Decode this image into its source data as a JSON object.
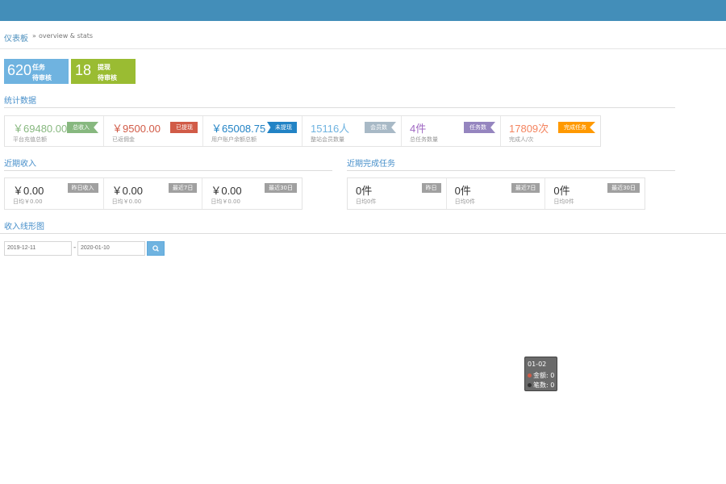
{
  "breadcrumb": {
    "home": "仪表板",
    "separator": "»",
    "sub": "overview & stats"
  },
  "infoboxes": [
    {
      "number": "620",
      "line1": "任务",
      "line2": "待审核"
    },
    {
      "number": "18",
      "line1": "提现",
      "line2": "待审核"
    }
  ],
  "stats": {
    "title": "统计数据",
    "cells": [
      {
        "value": "￥69480.00",
        "sub": "平台充值总额",
        "badge": "总收入",
        "color": "#87b87f",
        "badge_color": "#87b87f"
      },
      {
        "value": "￥9500.00",
        "sub": "已返佣金",
        "badge": "已提现",
        "color": "#d15b47",
        "badge_color": "#d15b47"
      },
      {
        "value": "￥65008.75",
        "sub": "用户账户余额总额",
        "badge": "未提现",
        "color": "#2283c5",
        "badge_color": "#2283c5"
      },
      {
        "value": "15116人",
        "sub": "整站会员数量",
        "badge": "会员数",
        "color": "#6fb3e0",
        "badge_color": "#a8b9c6"
      },
      {
        "value": "4件",
        "sub": "总任务数量",
        "badge": "任务数",
        "color": "#a069c3",
        "badge_color": "#9585bf"
      },
      {
        "value": "17809次",
        "sub": "完成人/次",
        "badge": "完成任务",
        "color": "#f4845f",
        "badge_color": "#ff9900"
      }
    ]
  },
  "income": {
    "title": "近期收入",
    "cells": [
      {
        "value": "￥0.00",
        "sub": "日均￥0.00",
        "badge": "昨日收入"
      },
      {
        "value": "￥0.00",
        "sub": "日均￥0.00",
        "badge": "最近7日"
      },
      {
        "value": "￥0.00",
        "sub": "日均￥0.00",
        "badge": "最近30日"
      }
    ]
  },
  "tasks": {
    "title": "近期完成任务",
    "cells": [
      {
        "value": "0件",
        "sub": "日均0件",
        "badge": "昨日"
      },
      {
        "value": "0件",
        "sub": "日均0件",
        "badge": "最近7日"
      },
      {
        "value": "0件",
        "sub": "日均0件",
        "badge": "最近30日"
      }
    ]
  },
  "chart": {
    "title": "收入线形图",
    "start_date": "2019-12-11",
    "date_separator": "-",
    "end_date": "2020-01-10",
    "search_icon": "search-icon",
    "tooltip": {
      "title": "01-02",
      "rows": [
        {
          "label": "金额: 0",
          "color": "#d15b47"
        },
        {
          "label": "笔数: 0",
          "color": "#333333"
        }
      ]
    }
  }
}
